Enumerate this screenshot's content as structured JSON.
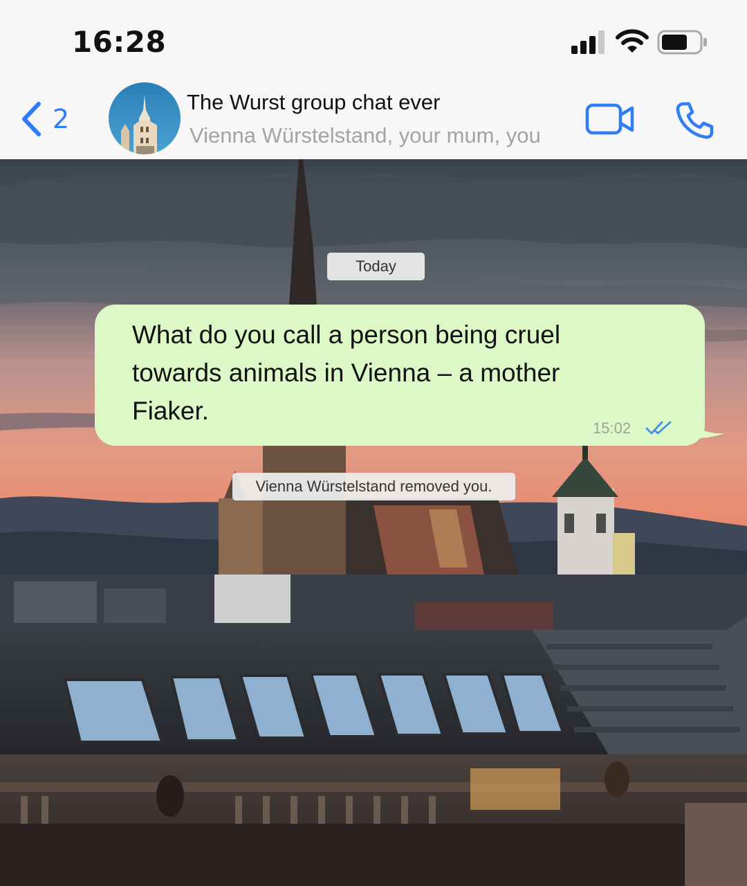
{
  "status_bar": {
    "time": "16:28"
  },
  "header": {
    "back_count": "2",
    "title": "The Wurst group chat ever",
    "members": "Vienna Würstelstand, your mum, you",
    "accent_color": "#2f7cf6"
  },
  "chat": {
    "date_label": "Today",
    "messages": [
      {
        "text": "What do you call a person being cruel towards animals in Vienna – a mother Fiaker.",
        "time": "15:02",
        "status": "read",
        "bubble_color": "#dcf8c6"
      }
    ],
    "system_notice": "Vienna Würstelstand removed you."
  },
  "icons": {
    "back": "chevron-left-icon",
    "video": "video-camera-icon",
    "call": "phone-icon",
    "signal": "signal-bars-icon",
    "wifi": "wifi-icon",
    "battery": "battery-icon",
    "ticks": "double-check-icon"
  }
}
